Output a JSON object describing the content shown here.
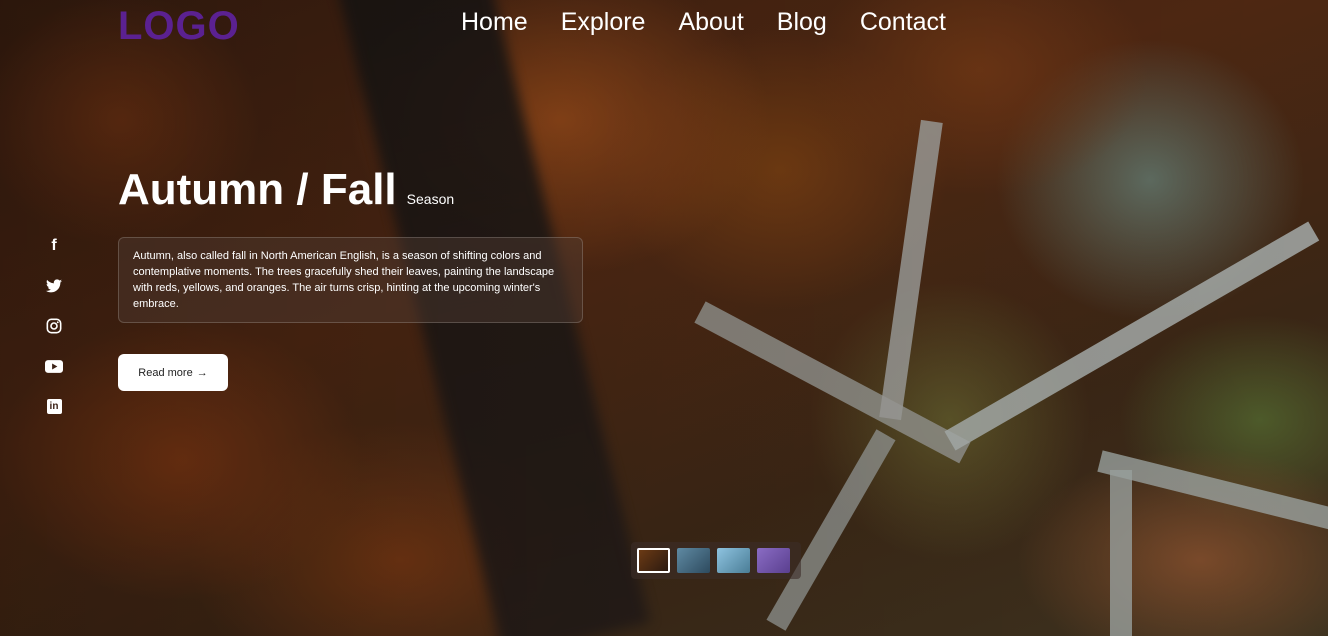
{
  "header": {
    "logo": "LOGO",
    "nav": [
      {
        "label": "Home"
      },
      {
        "label": "Explore"
      },
      {
        "label": "About"
      },
      {
        "label": "Blog"
      },
      {
        "label": "Contact"
      }
    ]
  },
  "hero": {
    "title": "Autumn / Fall",
    "subtitle": "Season",
    "description": "Autumn, also called fall in North American English, is a season of shifting colors and contemplative moments. The trees gracefully shed their leaves, painting the landscape with reds, yellows, and oranges. The air turns crisp, hinting at the upcoming winter's embrace.",
    "read_more_label": "Read more",
    "read_more_arrow": "→"
  },
  "social": [
    {
      "icon": "facebook-icon",
      "glyph": "f"
    },
    {
      "icon": "twitter-icon"
    },
    {
      "icon": "instagram-icon"
    },
    {
      "icon": "youtube-icon"
    },
    {
      "icon": "linkedin-icon",
      "glyph": "in"
    }
  ],
  "thumbnails": [
    {
      "name": "autumn",
      "active": true,
      "color_a": "#6b3a14",
      "color_b": "#2c1a10"
    },
    {
      "name": "winter",
      "active": false,
      "color_a": "#5f8aa3",
      "color_b": "#2d4a5e"
    },
    {
      "name": "summer",
      "active": false,
      "color_a": "#8ec3e0",
      "color_b": "#4a7d96"
    },
    {
      "name": "spring",
      "active": false,
      "color_a": "#8a6cc4",
      "color_b": "#5a3f8f"
    }
  ],
  "colors": {
    "logo": "#5b2191",
    "text": "#ffffff",
    "button_bg": "#ffffff"
  }
}
